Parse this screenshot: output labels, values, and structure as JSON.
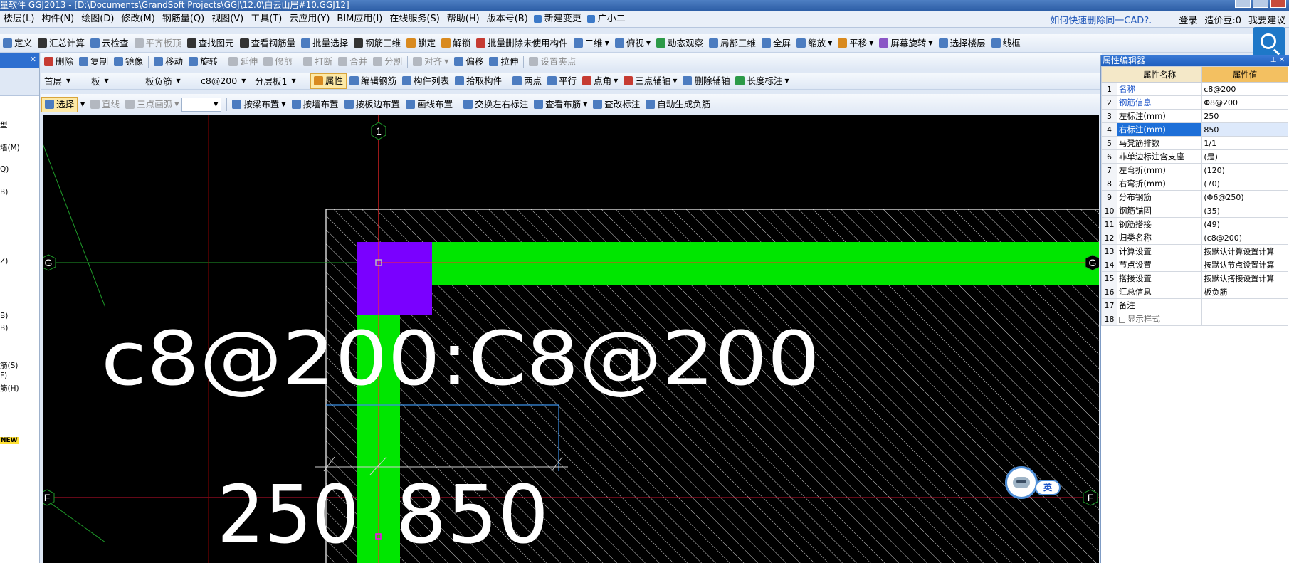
{
  "window": {
    "title": "量软件 GGJ2013 - [D:\\Documents\\GrandSoft Projects\\GGJ\\12.0\\白云山居#10.GGJ12]"
  },
  "menu": {
    "items": [
      "楼层(L)",
      "构件(N)",
      "绘图(D)",
      "修改(M)",
      "钢筋量(Q)",
      "视图(V)",
      "工具(T)",
      "云应用(Y)",
      "BIM应用(I)",
      "在线服务(S)",
      "帮助(H)",
      "版本号(B)"
    ],
    "new_change": "新建变更",
    "guangxiaoer": "广小二",
    "help_link": "如何快速删除同一CAD?.",
    "login": "登录",
    "price_beans": "造价豆:0",
    "suggest": "我要建议"
  },
  "toolbar1": [
    "定义",
    "汇总计算",
    "云检查",
    "平齐板顶",
    "查找图元",
    "查看钢筋量",
    "批量选择",
    "钢筋三维",
    "锁定",
    "解锁",
    "批量删除未使用构件",
    "二维",
    "俯视",
    "动态观察",
    "局部三维",
    "全屏",
    "缩放",
    "平移",
    "屏幕旋转",
    "选择楼层",
    "线框"
  ],
  "toolbar2": [
    "删除",
    "复制",
    "镜像",
    "移动",
    "旋转",
    "延伸",
    "修剪",
    "打断",
    "合并",
    "分割",
    "对齐",
    "偏移",
    "拉伸",
    "设置夹点"
  ],
  "toolbar3": {
    "floor": "首层",
    "element_type": "板",
    "sub_type": "板负筋",
    "element": "c8@200",
    "layer": "分层板1",
    "buttons": [
      "属性",
      "编辑钢筋",
      "构件列表",
      "拾取构件",
      "两点",
      "平行",
      "点角",
      "三点辅轴",
      "删除辅轴",
      "长度标注"
    ]
  },
  "toolbar4": [
    "选择",
    "直线",
    "三点画弧",
    "按梁布置",
    "按墙布置",
    "按板边布置",
    "画线布置",
    "交换左右标注",
    "查看布筋",
    "查改标注",
    "自动生成负筋"
  ],
  "left_panel": {
    "items": [
      "型",
      "墙(M)",
      "Q)",
      "B)",
      "Z)",
      "B)",
      "B)",
      "筋(S)",
      "F)",
      "筋(H)"
    ],
    "new_badge": "NEW"
  },
  "canvas": {
    "annotation_main": "c8@200:C8@200",
    "dim_left": "250",
    "dim_right": "850",
    "axis_labels": [
      "1",
      "G",
      "G",
      "F",
      "F"
    ]
  },
  "property_editor": {
    "title": "属性编辑器",
    "col_name": "属性名称",
    "col_value": "属性值",
    "rows": [
      {
        "idx": "1",
        "name": "名称",
        "value": "c8@200"
      },
      {
        "idx": "2",
        "name": "钢筋信息",
        "value": "Φ8@200"
      },
      {
        "idx": "3",
        "name": "左标注(mm)",
        "value": "250"
      },
      {
        "idx": "4",
        "name": "右标注(mm)",
        "value": "850"
      },
      {
        "idx": "5",
        "name": "马凳筋排数",
        "value": "1/1"
      },
      {
        "idx": "6",
        "name": "非单边标注含支座",
        "value": "(是)"
      },
      {
        "idx": "7",
        "name": "左弯折(mm)",
        "value": "(120)"
      },
      {
        "idx": "8",
        "name": "右弯折(mm)",
        "value": "(70)"
      },
      {
        "idx": "9",
        "name": "分布钢筋",
        "value": "(Φ6@250)"
      },
      {
        "idx": "10",
        "name": "钢筋锚固",
        "value": "(35)"
      },
      {
        "idx": "11",
        "name": "钢筋搭接",
        "value": "(49)"
      },
      {
        "idx": "12",
        "name": "归类名称",
        "value": "(c8@200)"
      },
      {
        "idx": "13",
        "name": "计算设置",
        "value": "按默认计算设置计算"
      },
      {
        "idx": "14",
        "name": "节点设置",
        "value": "按默认节点设置计算"
      },
      {
        "idx": "15",
        "name": "搭接设置",
        "value": "按默认搭接设置计算"
      },
      {
        "idx": "16",
        "name": "汇总信息",
        "value": "板负筋"
      },
      {
        "idx": "17",
        "name": "备注",
        "value": ""
      },
      {
        "idx": "18",
        "name": "显示样式",
        "value": ""
      }
    ]
  },
  "assistant": {
    "lang": "英"
  }
}
